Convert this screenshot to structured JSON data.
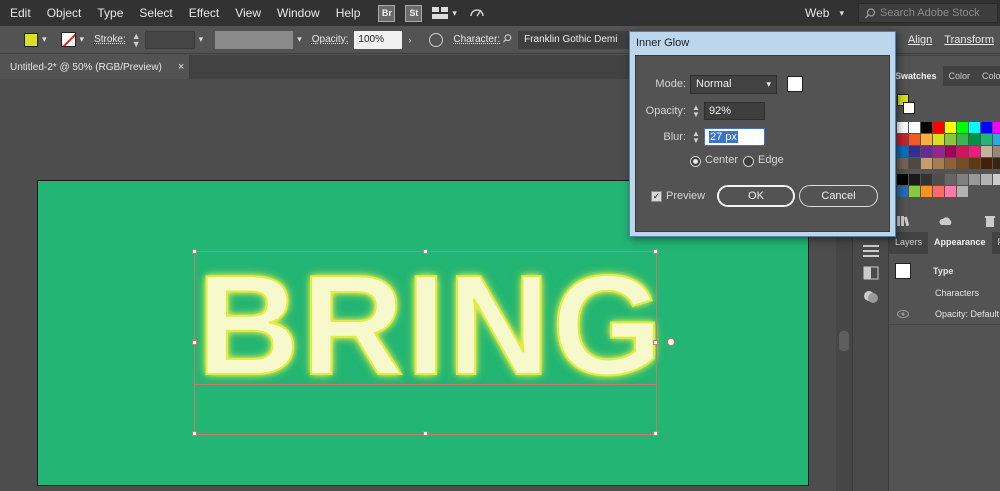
{
  "menubar": {
    "items": [
      "Edit",
      "Object",
      "Type",
      "Select",
      "Effect",
      "View",
      "Window",
      "Help"
    ],
    "bridge": "Br",
    "stock": "St",
    "workspace": "Web",
    "search_placeholder": "Search Adobe Stock"
  },
  "controlbar": {
    "fill_color": "#d7e021",
    "stroke_label": "Stroke:",
    "opacity_label": "Opacity:",
    "opacity_value": "100%",
    "character_label": "Character:",
    "font_name": "Franklin Gothic Demi",
    "align_label": "Align",
    "transform_label": "Transform"
  },
  "document": {
    "tab_title": "Untitled-2* @ 50% (RGB/Preview)",
    "close_glyph": "×",
    "artboard_text": "BRING",
    "artboard_color": "#22b573"
  },
  "dialog": {
    "title": "Inner Glow",
    "mode_label": "Mode:",
    "mode_value": "Normal",
    "opacity_label": "Opacity:",
    "opacity_value": "92%",
    "blur_label": "Blur:",
    "blur_value": "27 px",
    "center_label": "Center",
    "edge_label": "Edge",
    "preview_label": "Preview",
    "ok_label": "OK",
    "cancel_label": "Cancel"
  },
  "panels": {
    "swatches_tabs": [
      "Swatches",
      "Color",
      "Color"
    ],
    "appearance_tabs": [
      "Layers",
      "Appearance",
      "P"
    ],
    "appearance_rows": [
      "Type",
      "Characters",
      "Opacity: Default"
    ]
  }
}
